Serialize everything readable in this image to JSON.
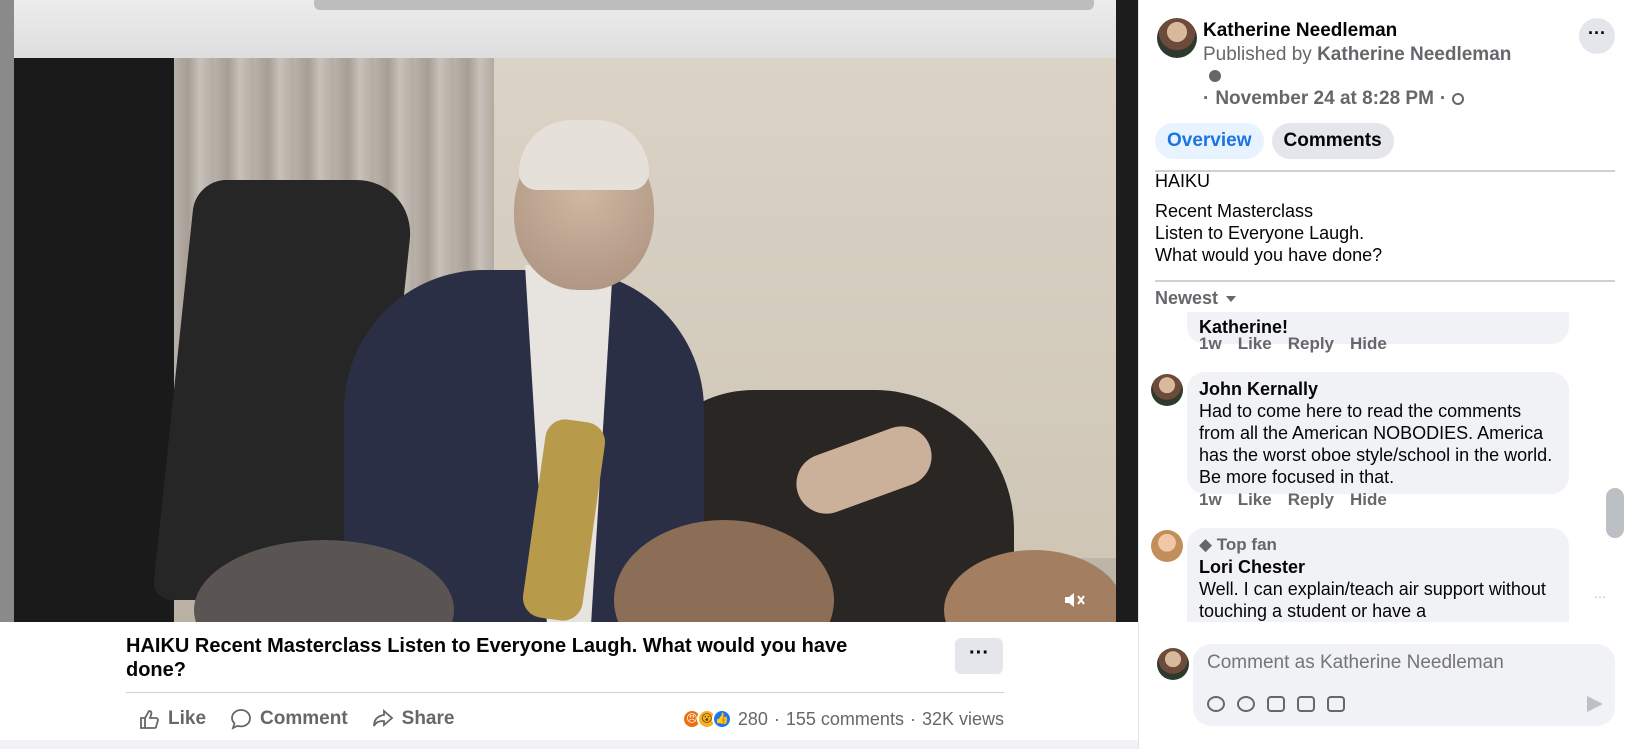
{
  "video": {
    "title": "HAIKU Recent Masterclass Listen to Everyone Laugh. What would you have done?",
    "more_label": "···",
    "mute_icon": "volume-muted-icon"
  },
  "actions": {
    "like": "Like",
    "comment": "Comment",
    "share": "Share"
  },
  "stats": {
    "reaction_count": "280",
    "comments": "155 comments",
    "views": "32K views",
    "separator": "·",
    "reaction_icons": [
      "angry-reaction-icon",
      "wow-reaction-icon",
      "like-reaction-icon"
    ]
  },
  "post": {
    "author": "Katherine Needleman",
    "published_prefix": "Published by",
    "published_by": "Katherine Needleman",
    "date_prefix": "·",
    "date": "November 24 at 8:28 PM",
    "date_suffix": "·",
    "more_label": "···"
  },
  "tabs": {
    "overview": "Overview",
    "comments": "Comments"
  },
  "description": {
    "title": "HAIKU",
    "lines": [
      "Recent Masterclass",
      "Listen to Everyone Laugh.",
      "What would you have done?"
    ]
  },
  "sort": {
    "label": "Newest"
  },
  "comments": [
    {
      "partial_text": "Katherine!",
      "time": "1w",
      "like": "Like",
      "reply": "Reply",
      "hide": "Hide"
    },
    {
      "name": "John Kernally",
      "text": "Had to come here to read the comments from all the American NOBODIES. America has the worst oboe style/school in the world. Be more focused in that.",
      "time": "1w",
      "like": "Like",
      "reply": "Reply",
      "hide": "Hide"
    },
    {
      "badge": "Top fan",
      "name": "Lori Chester",
      "text": "Well. I can explain/teach air support without touching a student or have a"
    }
  ],
  "composer": {
    "placeholder": "Comment as Katherine Needleman",
    "icons": [
      "avatar-sticker-icon",
      "emoji-icon",
      "camera-icon",
      "gif-icon",
      "sticker-icon"
    ],
    "send_icon": "send-icon"
  },
  "colors": {
    "accent": "#1b74e4",
    "secondary_text": "#65676b",
    "bubble": "#f0f2f5"
  }
}
